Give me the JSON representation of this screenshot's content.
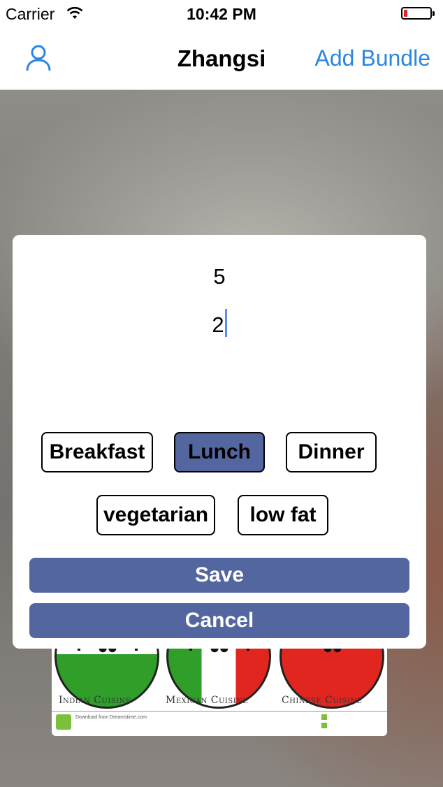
{
  "status_bar": {
    "carrier": "Carrier",
    "time": "10:42 PM",
    "battery_level": 0.15
  },
  "nav": {
    "title": "Zhangsi",
    "action": "Add Bundle",
    "user_icon": "user-icon"
  },
  "dialog": {
    "value1": "5",
    "value2": "2",
    "meal_tags": [
      {
        "label": "Breakfast",
        "selected": false
      },
      {
        "label": "Lunch",
        "selected": true
      },
      {
        "label": "Dinner",
        "selected": false
      }
    ],
    "diet_tags": [
      {
        "label": "vegetarian",
        "selected": false
      },
      {
        "label": "low fat",
        "selected": false
      }
    ],
    "save_label": "Save",
    "cancel_label": "Cancel",
    "accent_color": "#5466a0"
  },
  "background_image": {
    "labels": [
      "Indian Cuisine",
      "Mexican Cuisine",
      "Chinese Cuisine"
    ],
    "footer": "Download from Dreamstime.com"
  }
}
